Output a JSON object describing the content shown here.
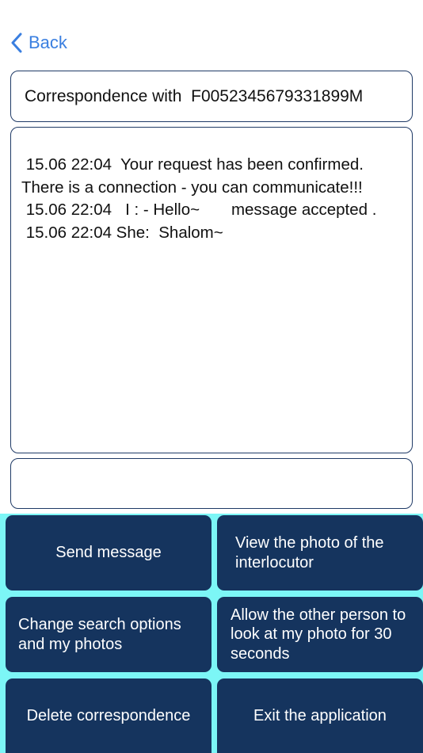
{
  "nav": {
    "back_label": "Back",
    "back_icon": "chevron-left-icon"
  },
  "header": {
    "title": "Correspondence with  F0052345679331899M"
  },
  "chat": {
    "lines": [
      " 15.06 22:04  Your request has been confirmed.",
      "There is a connection - you can communicate!!!",
      " 15.06 22:04   I : - Hello~       message accepted .",
      " 15.06 22:04 She:  Shalom~"
    ]
  },
  "message_input": {
    "value": "",
    "placeholder": ""
  },
  "buttons": {
    "send_message": "Send message",
    "view_photo": "View the photo of the interlocutor",
    "change_search": "Change search options and my photos",
    "allow_photo": "Allow the other person to look at my photo for 30 seconds",
    "delete_correspondence": "Delete correspondence",
    "exit_app": "Exit the application"
  },
  "colors": {
    "accent": "#3a7fe0",
    "button_bg": "#15345e",
    "button_area_bg": "#7cf6f6",
    "border": "#1f3a66"
  }
}
